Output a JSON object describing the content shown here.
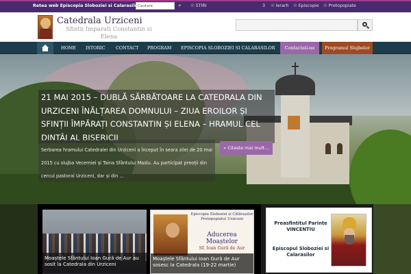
{
  "topbar": {
    "network_label": "Retea web Episcopia Sloboziei si Calarasilor",
    "search_placeholder": "Cautare",
    "links": [
      "STIRI",
      "Ierarh",
      "Episcopie",
      "Protopopiate"
    ],
    "count": "3"
  },
  "header": {
    "title": "Catedrala Urziceni",
    "subtitle": "Sfintii Imparati Constantin si Elena"
  },
  "nav": {
    "items": [
      "HOME",
      "ISTORIC",
      "CONTACT",
      "PROGRAM",
      "EPISCOPIA SLOBOZIEI SI CALARASILOR"
    ],
    "contact_button": "Contactati-ne",
    "program_button": "Programul Slujbelor"
  },
  "hero": {
    "title": "21 MAI 2015 – DUBLĂ SĂRBĂTOARE LA CATEDRALA DIN URZICENI ÎNĂLȚAREA DOMNULUI – ZIUA EROILOR ȘI SFINȚII ÎMPĂRAȚI CONSTANTIN ȘI ELENA – HRAMUL CEL DINTÂI AL BISERICII",
    "excerpt": "Serbarea hramului Catedralei din Urziceni a început în seara zilei de 20 mai 2015 cu slujba Vecerniei și Taina Sfântului Maslu. Au participat preoții din cercul pastoral Urziceni, dar și din …",
    "read_more": "» Citeste mai mult…"
  },
  "cards": [
    {
      "caption": "Moaștele Sfântului Ioan Gură de Aur au sosit la Catedrala din Urziceni"
    },
    {
      "poster_head": "Episcopia Sloboziei și Călărașilor Protopopiatul Urziceni",
      "poster_title": "Aducerea Moaștelor",
      "poster_sub": "Sf. Ioan Gură de Aur",
      "caption": "Moaștele Sfântului Ioan Gură de Aur sosesc la Catedrala (19-22 martie)"
    }
  ],
  "bishop": {
    "line1": "Preasfintitul Parinte VINCENTIU",
    "line2": "Episcopul Sloboziei si Calarasilor"
  }
}
